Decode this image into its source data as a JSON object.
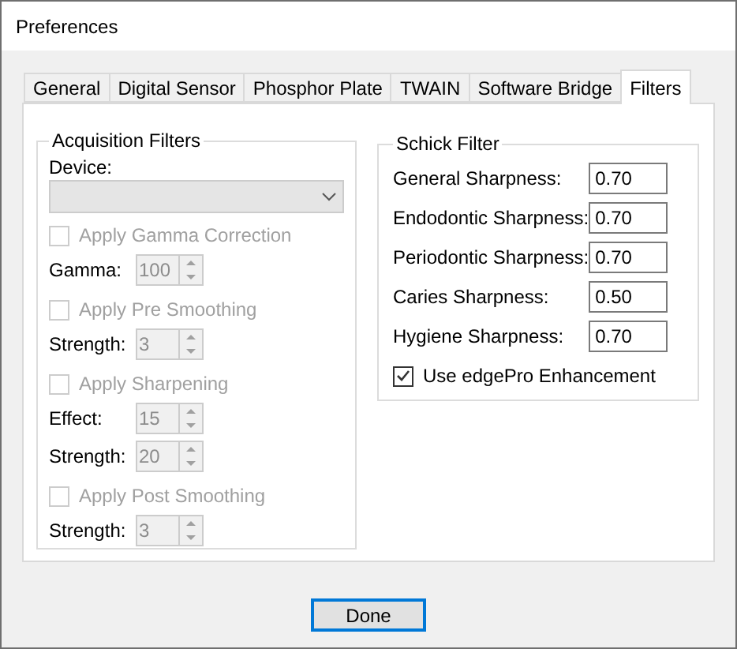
{
  "window": {
    "title": "Preferences"
  },
  "tabs": [
    {
      "label": "General",
      "selected": false
    },
    {
      "label": "Digital Sensor",
      "selected": false
    },
    {
      "label": "Phosphor Plate",
      "selected": false
    },
    {
      "label": "TWAIN",
      "selected": false
    },
    {
      "label": "Software Bridge",
      "selected": false
    },
    {
      "label": "Filters",
      "selected": true
    }
  ],
  "acquisition_filters": {
    "title": "Acquisition Filters",
    "device_label": "Device:",
    "device_disabled": true,
    "items": [
      {
        "kind": "checkbox",
        "label": "Apply Gamma Correction",
        "checked": false,
        "disabled": true
      },
      {
        "kind": "spinner",
        "label": "Gamma:",
        "value": "100",
        "disabled": true
      },
      {
        "kind": "checkbox",
        "label": "Apply Pre Smoothing",
        "checked": false,
        "disabled": true
      },
      {
        "kind": "spinner",
        "label": "Strength:",
        "value": "3",
        "disabled": true
      },
      {
        "kind": "checkbox",
        "label": "Apply Sharpening",
        "checked": false,
        "disabled": true
      },
      {
        "kind": "spinner",
        "label": "Effect:",
        "value": "15",
        "disabled": true
      },
      {
        "kind": "spinner",
        "label": "Strength:",
        "value": "20",
        "disabled": true
      },
      {
        "kind": "checkbox",
        "label": "Apply Post Smoothing",
        "checked": false,
        "disabled": true
      },
      {
        "kind": "spinner",
        "label": "Strength:",
        "value": "3",
        "disabled": true
      }
    ]
  },
  "schick_filter": {
    "title": "Schick Filter",
    "fields": [
      {
        "label": "General Sharpness:",
        "value": "0.70"
      },
      {
        "label": "Endodontic Sharpness:",
        "value": "0.70"
      },
      {
        "label": "Periodontic Sharpness:",
        "value": "0.70"
      },
      {
        "label": "Caries Sharpness:",
        "value": "0.50"
      },
      {
        "label": "Hygiene Sharpness:",
        "value": "0.70"
      }
    ],
    "edgepro": {
      "label": "Use edgePro Enhancement",
      "checked": true,
      "disabled": false
    }
  },
  "buttons": [
    {
      "label": "Done"
    }
  ]
}
